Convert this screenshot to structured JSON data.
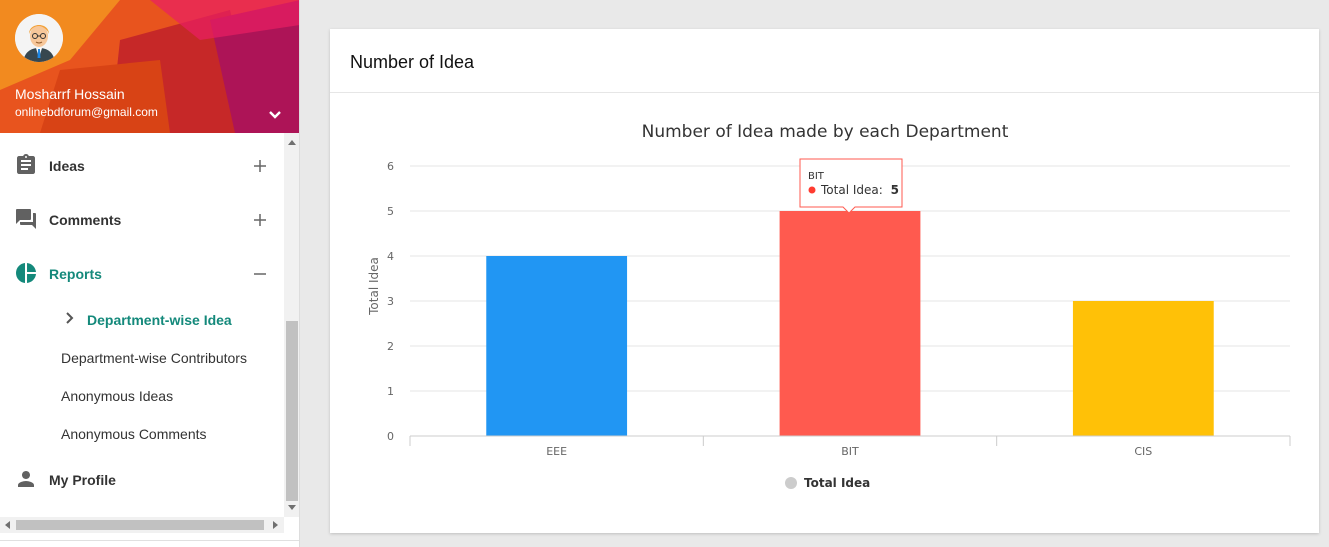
{
  "user": {
    "name": "Mosharrf Hossain",
    "email": "onlinebdforum@gmail.com"
  },
  "colors": {
    "accent": "#14897b",
    "header_base": "#e8541e"
  },
  "menu": {
    "items": [
      {
        "label": "Ideas",
        "icon": "clipboard-icon",
        "toggle": "+"
      },
      {
        "label": "Comments",
        "icon": "forum-icon",
        "toggle": "+"
      },
      {
        "label": "Reports",
        "icon": "pie-chart-icon",
        "toggle": "–"
      },
      {
        "label": "My Profile",
        "icon": "person-icon"
      }
    ],
    "report_subitems": [
      {
        "label": "Department-wise Idea",
        "active": true
      },
      {
        "label": "Department-wise Contributors"
      },
      {
        "label": "Anonymous Ideas"
      },
      {
        "label": "Anonymous Comments"
      }
    ]
  },
  "card": {
    "title": "Number of Idea"
  },
  "chart_data": {
    "type": "bar",
    "title": "Number of Idea made by each Department",
    "categories": [
      "EEE",
      "BIT",
      "CIS"
    ],
    "series": [
      {
        "name": "Total Idea",
        "values": [
          4,
          5,
          3
        ]
      }
    ],
    "bar_colors": [
      "#2196f3",
      "#ff5a4f",
      "#ffc107"
    ],
    "ylabel": "Total Idea",
    "ylim": [
      0,
      6
    ],
    "yticks": [
      "0",
      "1",
      "2",
      "3",
      "4",
      "5",
      "6"
    ],
    "legend_position": "bottom",
    "grid": true,
    "tooltip": {
      "category": "BIT",
      "series_label": "Total Idea:",
      "value": "5"
    }
  }
}
